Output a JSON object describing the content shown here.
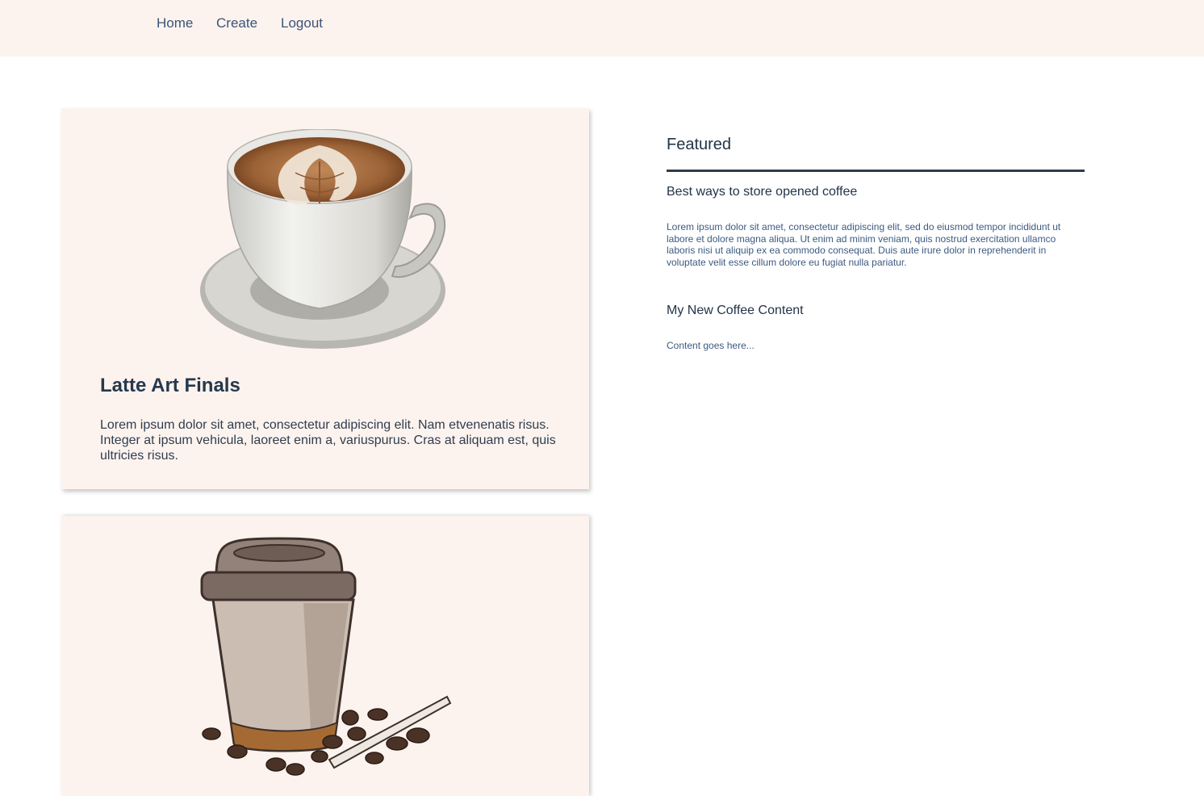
{
  "nav": {
    "items": [
      {
        "label": "Home"
      },
      {
        "label": "Create"
      },
      {
        "label": "Logout"
      }
    ]
  },
  "cards": [
    {
      "image": "latte-art-cup-illustration",
      "title": "Latte Art Finals",
      "text": "Lorem ipsum dolor sit amet, consectetur adipiscing elit. Nam etvenenatis risus. Integer at ipsum vehicula, laoreet enim a, variuspurus. Cras at aliquam est, quis ultricies risus."
    },
    {
      "image": "takeaway-coffee-cup-illustration"
    }
  ],
  "featured": {
    "heading": "Featured",
    "posts": [
      {
        "title": "Best ways to store opened coffee",
        "text": "Lorem ipsum dolor sit amet, consectetur adipiscing elit, sed do eiusmod tempor incididunt ut labore et dolore magna aliqua. Ut enim ad minim veniam, quis nostrud exercitation ullamco laboris nisi ut aliquip ex ea commodo consequat. Duis aute irure dolor in reprehenderit in voluptate velit esse cillum dolore eu fugiat nulla pariatur."
      },
      {
        "title": "My New Coffee Content",
        "text": "Content goes here..."
      }
    ]
  },
  "colors": {
    "nav_background": "#fdf3ee",
    "card_background": "#fdf3ee",
    "heading_text": "#233447",
    "link_text": "#3a5478"
  }
}
